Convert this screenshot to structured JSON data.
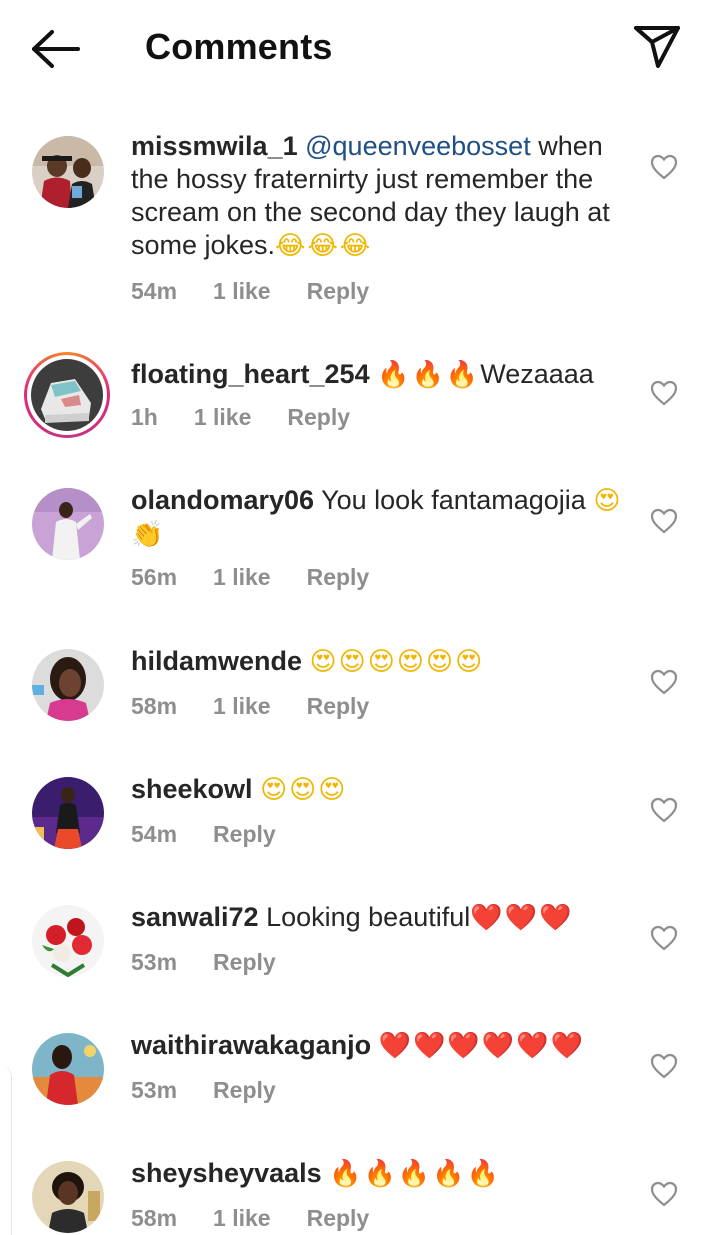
{
  "header": {
    "title": "Comments",
    "back_icon": "arrow-left-icon",
    "share_icon": "paper-plane-icon"
  },
  "comments": [
    {
      "username": "missmwila_1",
      "mention": "@queenveebosset",
      "text": " when the hossy fraternirty just remember the scream on the second day they laugh at some jokes.",
      "emoji": "😂😂😂",
      "time": "54m",
      "likes": "1 like",
      "reply": "Reply"
    },
    {
      "username": "floating_heart_254",
      "text": "",
      "emoji": "🔥🔥🔥",
      "text_after": "Wezaaaa",
      "time": "1h",
      "likes": "1 like",
      "reply": "Reply",
      "has_story": true
    },
    {
      "username": "olandomary06",
      "text": " You look fantamagojia",
      "emoji": "😍👏",
      "time": "56m",
      "likes": "1 like",
      "reply": "Reply"
    },
    {
      "username": "hildamwende",
      "text": " ",
      "emoji": "😍😍😍😍😍😍",
      "time": "58m",
      "likes": "1 like",
      "reply": "Reply"
    },
    {
      "username": "sheekowl",
      "text": " ",
      "emoji": "😍😍😍",
      "time": "54m",
      "reply": "Reply"
    },
    {
      "username": "sanwali72",
      "text": " Looking beautiful",
      "emoji": "❤️❤️❤️",
      "time": "53m",
      "reply": "Reply"
    },
    {
      "username": "waithirawakaganjo",
      "text": " ",
      "emoji": "❤️❤️❤️❤️❤️❤️",
      "time": "53m",
      "reply": "Reply"
    },
    {
      "username": "sheysheyvaals",
      "text": " ",
      "emoji": "🔥🔥🔥🔥🔥",
      "time": "58m",
      "likes": "1 like",
      "reply": "Reply"
    }
  ],
  "colors": {
    "mention": "#1f4f85",
    "meta": "#8e8e8e",
    "story_ring": "#dd2a7b"
  }
}
